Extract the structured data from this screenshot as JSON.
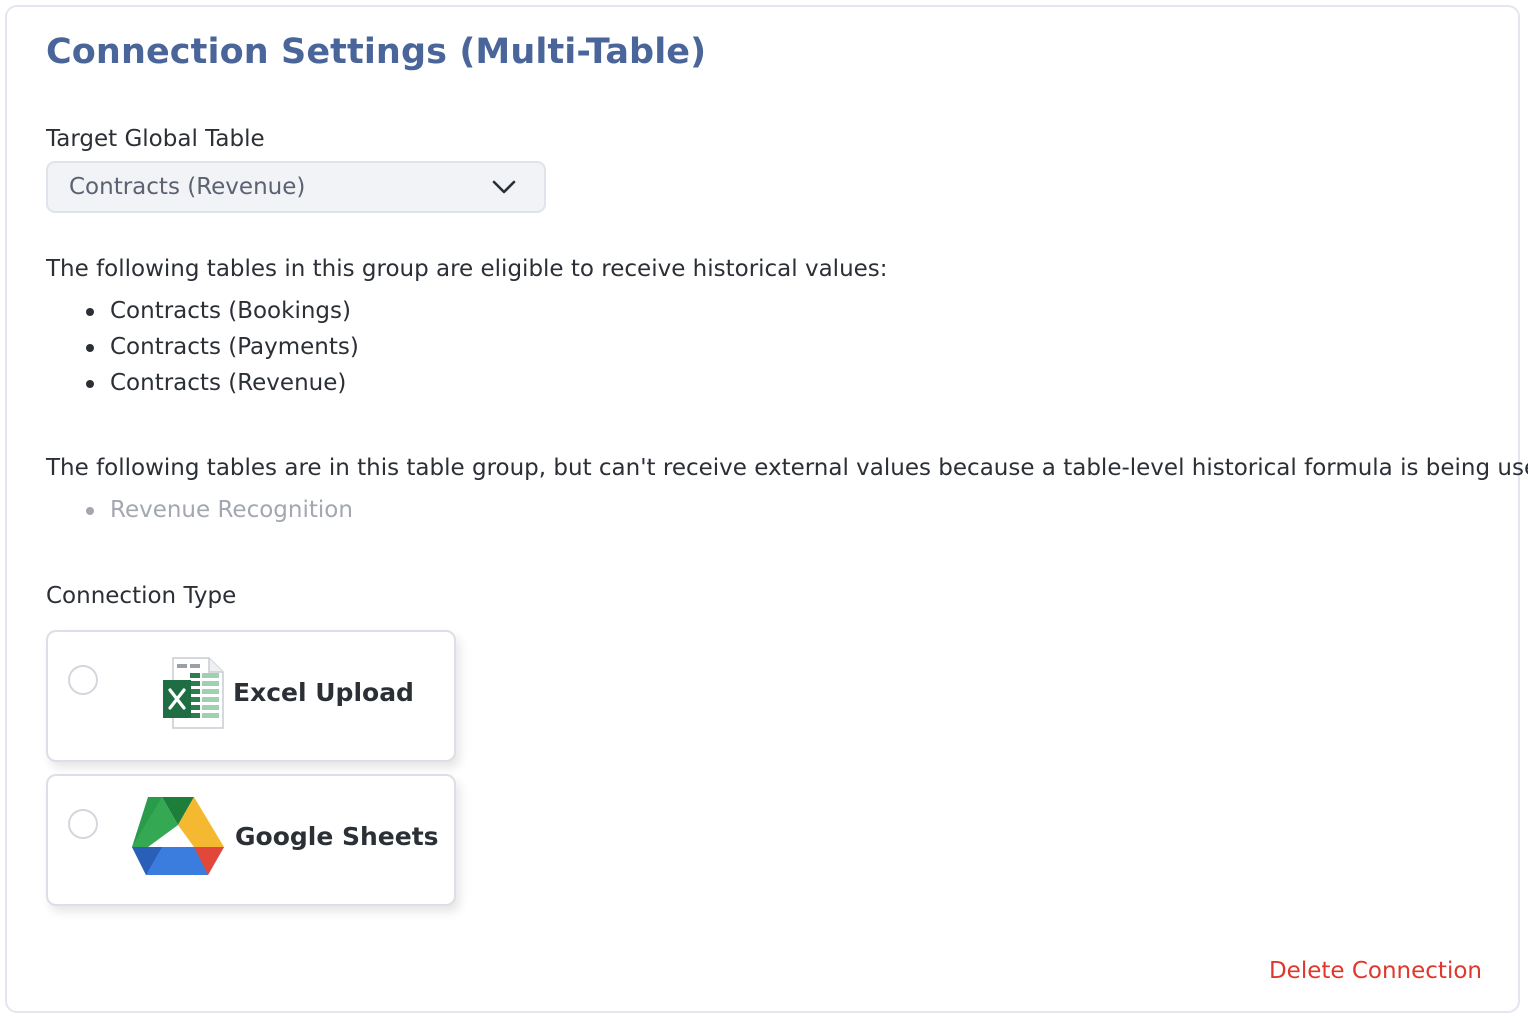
{
  "page": {
    "title": "Connection Settings (Multi-Table)"
  },
  "target_table": {
    "label": "Target Global Table",
    "selected": "Contracts (Revenue)"
  },
  "eligible": {
    "intro": "The following tables in this group are eligible to receive historical values:",
    "items": [
      "Contracts (Bookings)",
      "Contracts (Payments)",
      "Contracts (Revenue)"
    ]
  },
  "ineligible": {
    "intro": "The following tables are in this table group, but can't receive external values because a table-level historical formula is being used:",
    "items": [
      "Revenue Recognition"
    ]
  },
  "connection_type": {
    "label": "Connection Type",
    "options": [
      {
        "label": "Excel Upload",
        "icon": "excel-icon",
        "selected": false
      },
      {
        "label": "Google Sheets",
        "icon": "google-drive-icon",
        "selected": false
      }
    ]
  },
  "actions": {
    "delete_label": "Delete Connection"
  },
  "colors": {
    "title": "#4a6599",
    "danger": "#e0372d",
    "muted": "#a2a7b0"
  }
}
